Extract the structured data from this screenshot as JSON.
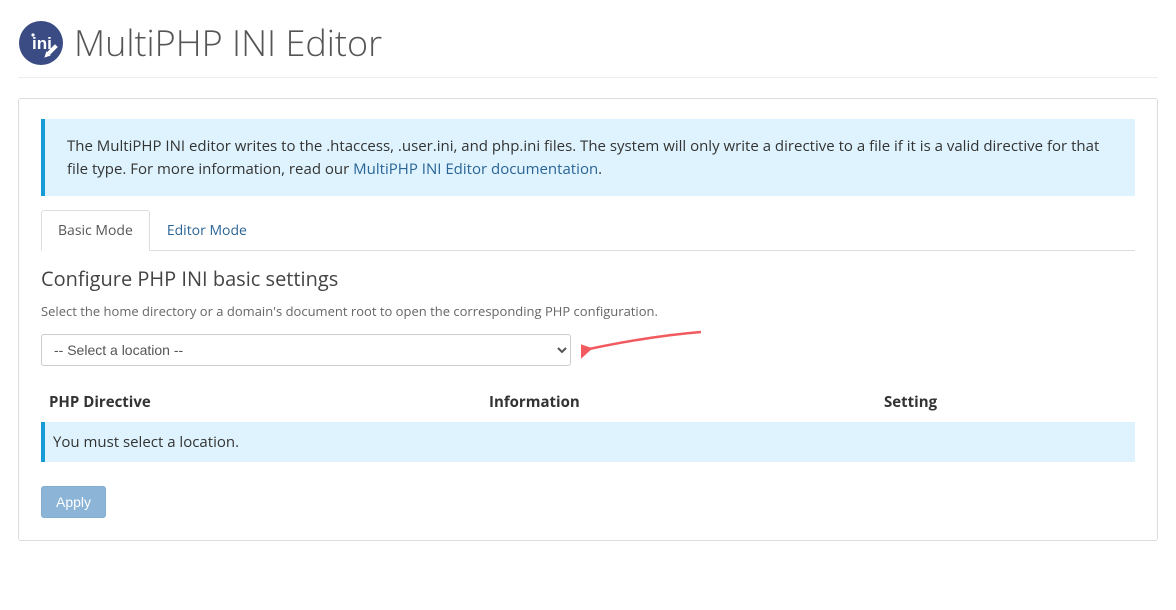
{
  "header": {
    "title": "MultiPHP INI Editor"
  },
  "alert": {
    "text_before_link": "The MultiPHP INI editor writes to the .htaccess, .user.ini, and php.ini files. The system will only write a directive to a file if it is a valid directive for that file type. For more information, read our ",
    "link_text": "MultiPHP INI Editor documentation",
    "text_after_link": "."
  },
  "tabs": {
    "basic": "Basic Mode",
    "editor": "Editor Mode"
  },
  "section": {
    "heading": "Configure PHP INI basic settings",
    "help": "Select the home directory or a domain's document root to open the corresponding PHP configuration.",
    "select_placeholder": "-- Select a location --"
  },
  "table": {
    "headers": {
      "directive": "PHP Directive",
      "information": "Information",
      "setting": "Setting"
    },
    "empty_message": "You must select a location."
  },
  "buttons": {
    "apply": "Apply"
  },
  "colors": {
    "info_bg": "#def3fd",
    "info_border": "#179bd7",
    "link": "#2a6496",
    "arrow": "#f15a5f"
  }
}
